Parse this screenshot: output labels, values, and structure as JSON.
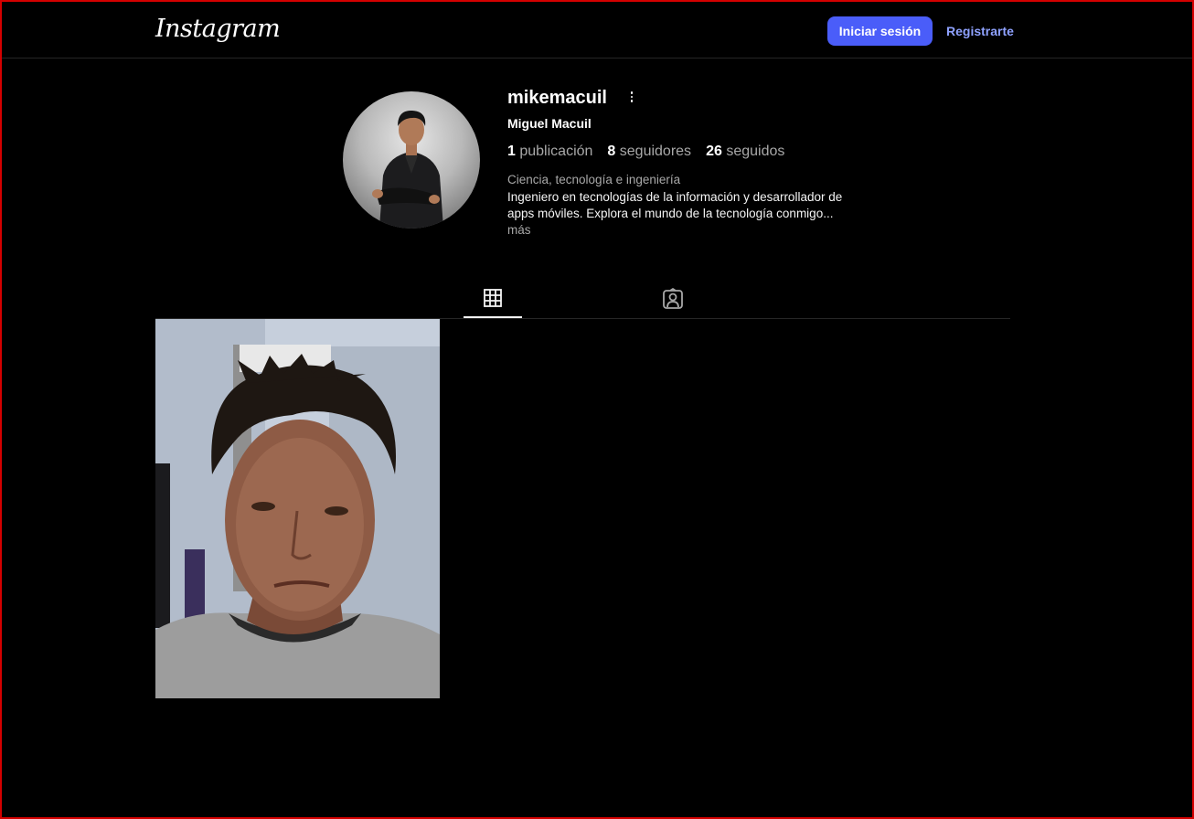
{
  "header": {
    "logo": "Instagram",
    "login_label": "Iniciar sesión",
    "register_label": "Registrarte"
  },
  "profile": {
    "username": "mikemacuil",
    "full_name": "Miguel Macuil",
    "stats": {
      "posts_count": "1",
      "posts_label": "publicación",
      "followers_count": "8",
      "followers_label": "seguidores",
      "following_count": "26",
      "following_label": "seguidos"
    },
    "category": "Ciencia, tecnología e ingeniería",
    "bio": "Ingeniero en tecnologías de la información y desarrollador de apps móviles. Explora el mundo de la tecnología conmigo...",
    "bio_more": "más"
  },
  "tabs": [
    {
      "icon": "grid-icon",
      "active": true
    },
    {
      "icon": "tagged-icon",
      "active": false
    }
  ],
  "posts": [
    {
      "kind": "photo"
    }
  ],
  "colors": {
    "background": "#000000",
    "accent_button": "#4a5df9",
    "link": "#8fa2ff",
    "secondary_text": "#a8a8a8"
  }
}
